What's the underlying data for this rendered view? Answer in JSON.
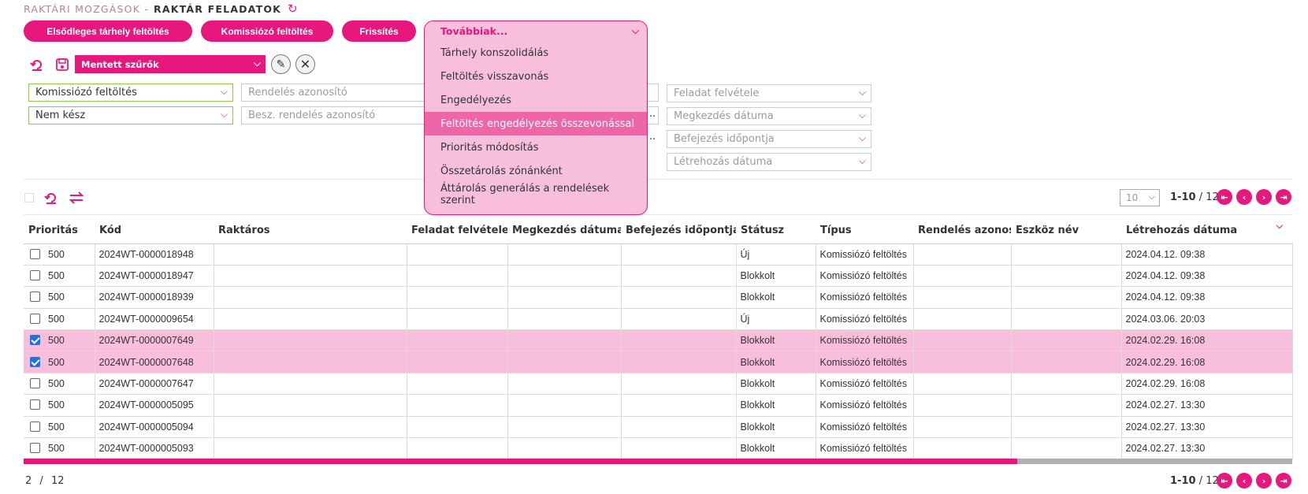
{
  "title": {
    "prefix": "RAKTÁRI MOZGÁSOK -",
    "main": "RAKTÁR FELADATOK"
  },
  "actions": {
    "primary_fill": "Elsődleges tárhely feltöltés",
    "picker_fill": "Komissiózó feltöltés",
    "refresh": "Frissítés",
    "more": "Továbbiak..."
  },
  "more_menu": {
    "items": [
      "Tárhely konszolidálás",
      "Feltöltés visszavonás",
      "Engedélyezés",
      "Feltöltés engedélyezés összevonással",
      "Prioritás módosítás",
      "Összetárolás zónánként",
      "Áttárolás generálás a rendelések szerint"
    ],
    "highlighted_index": 3
  },
  "saved_filters": {
    "label": "Mentett szűrők"
  },
  "filters": {
    "type_value": "Komissiózó feltöltés",
    "status_value": "Nem kész",
    "order_id_placeholder": "Rendelés azonosító",
    "purchase_order_placeholder": "Besz. rendelés azonosító",
    "task_taken_placeholder": "Feladat felvétele",
    "start_date_placeholder": "Megkezdés dátuma",
    "end_time_placeholder": "Befejezés időpontja",
    "created_date_placeholder": "Létrehozás dátuma"
  },
  "pager": {
    "page_size": "10",
    "range": "1-10",
    "separator": " / ",
    "total": "12"
  },
  "table": {
    "columns": [
      "Prioritás",
      "Kód",
      "Raktáros",
      "Feladat felvétele",
      "Megkezdés dátuma",
      "Befejezés időpontja",
      "Státusz",
      "Típus",
      "Rendelés azonosít",
      "Eszköz név",
      "Létrehozás dátuma"
    ],
    "rows": [
      {
        "checked": false,
        "priority": "500",
        "code": "2024WT-0000018948",
        "status": "Új",
        "type": "Komissiózó feltöltés",
        "created": "2024.04.12. 09:38"
      },
      {
        "checked": false,
        "priority": "500",
        "code": "2024WT-0000018947",
        "status": "Blokkolt",
        "type": "Komissiózó feltöltés",
        "created": "2024.04.12. 09:38"
      },
      {
        "checked": false,
        "priority": "500",
        "code": "2024WT-0000018939",
        "status": "Blokkolt",
        "type": "Komissiózó feltöltés",
        "created": "2024.04.12. 09:38"
      },
      {
        "checked": false,
        "priority": "500",
        "code": "2024WT-0000009654",
        "status": "Új",
        "type": "Komissiózó feltöltés",
        "created": "2024.03.06. 20:03"
      },
      {
        "checked": true,
        "priority": "500",
        "code": "2024WT-0000007649",
        "status": "Blokkolt",
        "type": "Komissiózó feltöltés",
        "created": "2024.02.29. 16:08"
      },
      {
        "checked": true,
        "priority": "500",
        "code": "2024WT-0000007648",
        "status": "Blokkolt",
        "type": "Komissiózó feltöltés",
        "created": "2024.02.29. 16:08"
      },
      {
        "checked": false,
        "priority": "500",
        "code": "2024WT-0000007647",
        "status": "Blokkolt",
        "type": "Komissiózó feltöltés",
        "created": "2024.02.29. 16:08"
      },
      {
        "checked": false,
        "priority": "500",
        "code": "2024WT-0000005095",
        "status": "Blokkolt",
        "type": "Komissiózó feltöltés",
        "created": "2024.02.27. 13:30"
      },
      {
        "checked": false,
        "priority": "500",
        "code": "2024WT-0000005094",
        "status": "Blokkolt",
        "type": "Komissiózó feltöltés",
        "created": "2024.02.27. 13:30"
      },
      {
        "checked": false,
        "priority": "500",
        "code": "2024WT-0000005093",
        "status": "Blokkolt",
        "type": "Komissiózó feltöltés",
        "created": "2024.02.27. 13:30"
      }
    ]
  },
  "footer": {
    "selected_count": "2",
    "separator": "/",
    "total": "12"
  },
  "icons": {
    "title_refresh": "refresh-icon",
    "reset": "undo-icon",
    "save": "save-icon",
    "edit": "pencil-icon",
    "delete": "close-icon",
    "swap": "swap-icon",
    "first": "first-page-icon",
    "prev": "prev-page-icon",
    "next": "next-page-icon",
    "last": "last-page-icon"
  },
  "colors": {
    "accent": "#e8177d",
    "menu_bg": "#f7bfdc",
    "menu_highlight": "#ee66a8",
    "selected_row": "#f7bfdc",
    "filter_active_border": "#8ccc46"
  }
}
